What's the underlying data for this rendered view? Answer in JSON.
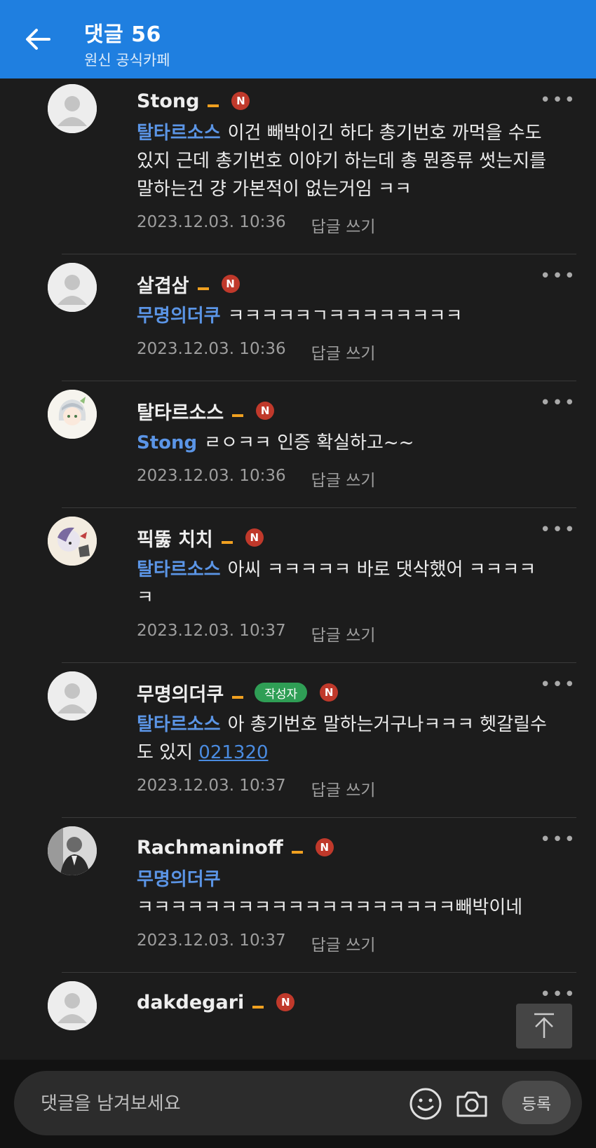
{
  "header": {
    "title": "댓글 56",
    "subtitle": "원신 공식카페"
  },
  "comments": [
    {
      "nick": "Stong",
      "mention": "탈타르소스",
      "text": "이건 빼박이긴 하다 총기번호 까먹을 수도 있지 근데 총기번호 이야기 하는데 총 뭔종류 썻는지를 말하는건 걍 가본적이 없는거임 ㅋㅋ",
      "time": "2023.12.03. 10:36",
      "reply": "답글 쓰기",
      "new": "N"
    },
    {
      "nick": "살겹삼",
      "mention": "무명의더쿠",
      "text": "ㅋㅋㅋㅋㅋㄱㅋㅋㅋㅋㅋㅋㅋㅋ",
      "time": "2023.12.03. 10:36",
      "reply": "답글 쓰기",
      "new": "N"
    },
    {
      "nick": "탈타르소스",
      "mention": "Stong",
      "text": "ㄹㅇㅋㅋ 인증 확실하고~~",
      "time": "2023.12.03. 10:36",
      "reply": "답글 쓰기",
      "new": "N"
    },
    {
      "nick": "픽뚫 치치",
      "mention": "탈타르소스",
      "text": "아씨 ㅋㅋㅋㅋㅋ 바로 댓삭했어 ㅋㅋㅋㅋㅋ",
      "time": "2023.12.03. 10:37",
      "reply": "답글 쓰기",
      "new": "N"
    },
    {
      "nick": "무명의더쿠",
      "author_badge": "작성자",
      "mention": "탈타르소스",
      "text": "아 총기번호 말하는거구나ㅋㅋㅋ 헷갈릴수도 있지",
      "link": "021320",
      "time": "2023.12.03. 10:37",
      "reply": "답글 쓰기",
      "new": "N"
    },
    {
      "nick": "Rachmaninoff",
      "mention": "무명의더쿠",
      "text": "ㅋㅋㅋㅋㅋㅋㅋㅋㅋㅋㅋㅋㅋㅋㅋㅋㅋㅋㅋ빼박이네",
      "time": "2023.12.03. 10:37",
      "reply": "답글 쓰기",
      "new": "N"
    },
    {
      "nick": "dakdegari",
      "new": "N"
    }
  ],
  "input": {
    "placeholder": "댓글을 남겨보세요",
    "submit_label": "등록"
  },
  "colors": {
    "appbar": "#1f7fe0",
    "mention": "#5b95e6",
    "new_badge": "#c0392b",
    "author_badge": "#2f9e55",
    "level": "#f0a020"
  },
  "icons": [
    "back-arrow-icon",
    "more-icon",
    "emoji-icon",
    "camera-icon",
    "scroll-top-icon"
  ]
}
